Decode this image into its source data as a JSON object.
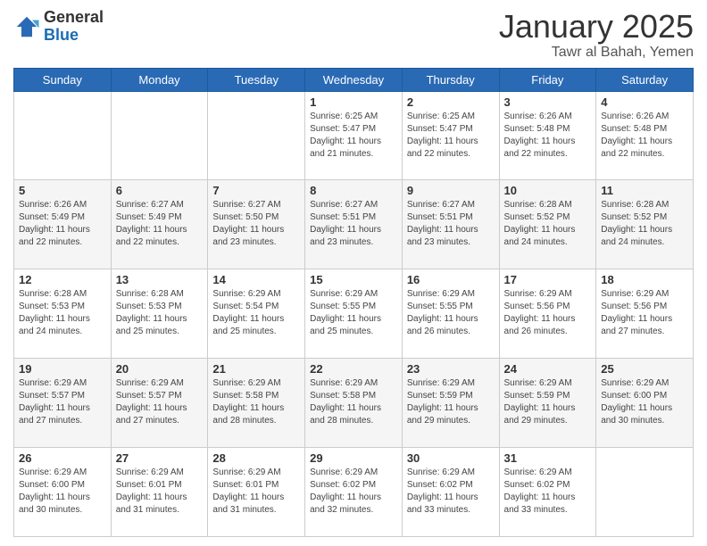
{
  "logo": {
    "general": "General",
    "blue": "Blue"
  },
  "header": {
    "title": "January 2025",
    "subtitle": "Tawr al Bahah, Yemen"
  },
  "weekdays": [
    "Sunday",
    "Monday",
    "Tuesday",
    "Wednesday",
    "Thursday",
    "Friday",
    "Saturday"
  ],
  "weeks": [
    [
      {
        "day": "",
        "info": ""
      },
      {
        "day": "",
        "info": ""
      },
      {
        "day": "",
        "info": ""
      },
      {
        "day": "1",
        "info": "Sunrise: 6:25 AM\nSunset: 5:47 PM\nDaylight: 11 hours\nand 21 minutes."
      },
      {
        "day": "2",
        "info": "Sunrise: 6:25 AM\nSunset: 5:47 PM\nDaylight: 11 hours\nand 22 minutes."
      },
      {
        "day": "3",
        "info": "Sunrise: 6:26 AM\nSunset: 5:48 PM\nDaylight: 11 hours\nand 22 minutes."
      },
      {
        "day": "4",
        "info": "Sunrise: 6:26 AM\nSunset: 5:48 PM\nDaylight: 11 hours\nand 22 minutes."
      }
    ],
    [
      {
        "day": "5",
        "info": "Sunrise: 6:26 AM\nSunset: 5:49 PM\nDaylight: 11 hours\nand 22 minutes."
      },
      {
        "day": "6",
        "info": "Sunrise: 6:27 AM\nSunset: 5:49 PM\nDaylight: 11 hours\nand 22 minutes."
      },
      {
        "day": "7",
        "info": "Sunrise: 6:27 AM\nSunset: 5:50 PM\nDaylight: 11 hours\nand 23 minutes."
      },
      {
        "day": "8",
        "info": "Sunrise: 6:27 AM\nSunset: 5:51 PM\nDaylight: 11 hours\nand 23 minutes."
      },
      {
        "day": "9",
        "info": "Sunrise: 6:27 AM\nSunset: 5:51 PM\nDaylight: 11 hours\nand 23 minutes."
      },
      {
        "day": "10",
        "info": "Sunrise: 6:28 AM\nSunset: 5:52 PM\nDaylight: 11 hours\nand 24 minutes."
      },
      {
        "day": "11",
        "info": "Sunrise: 6:28 AM\nSunset: 5:52 PM\nDaylight: 11 hours\nand 24 minutes."
      }
    ],
    [
      {
        "day": "12",
        "info": "Sunrise: 6:28 AM\nSunset: 5:53 PM\nDaylight: 11 hours\nand 24 minutes."
      },
      {
        "day": "13",
        "info": "Sunrise: 6:28 AM\nSunset: 5:53 PM\nDaylight: 11 hours\nand 25 minutes."
      },
      {
        "day": "14",
        "info": "Sunrise: 6:29 AM\nSunset: 5:54 PM\nDaylight: 11 hours\nand 25 minutes."
      },
      {
        "day": "15",
        "info": "Sunrise: 6:29 AM\nSunset: 5:55 PM\nDaylight: 11 hours\nand 25 minutes."
      },
      {
        "day": "16",
        "info": "Sunrise: 6:29 AM\nSunset: 5:55 PM\nDaylight: 11 hours\nand 26 minutes."
      },
      {
        "day": "17",
        "info": "Sunrise: 6:29 AM\nSunset: 5:56 PM\nDaylight: 11 hours\nand 26 minutes."
      },
      {
        "day": "18",
        "info": "Sunrise: 6:29 AM\nSunset: 5:56 PM\nDaylight: 11 hours\nand 27 minutes."
      }
    ],
    [
      {
        "day": "19",
        "info": "Sunrise: 6:29 AM\nSunset: 5:57 PM\nDaylight: 11 hours\nand 27 minutes."
      },
      {
        "day": "20",
        "info": "Sunrise: 6:29 AM\nSunset: 5:57 PM\nDaylight: 11 hours\nand 27 minutes."
      },
      {
        "day": "21",
        "info": "Sunrise: 6:29 AM\nSunset: 5:58 PM\nDaylight: 11 hours\nand 28 minutes."
      },
      {
        "day": "22",
        "info": "Sunrise: 6:29 AM\nSunset: 5:58 PM\nDaylight: 11 hours\nand 28 minutes."
      },
      {
        "day": "23",
        "info": "Sunrise: 6:29 AM\nSunset: 5:59 PM\nDaylight: 11 hours\nand 29 minutes."
      },
      {
        "day": "24",
        "info": "Sunrise: 6:29 AM\nSunset: 5:59 PM\nDaylight: 11 hours\nand 29 minutes."
      },
      {
        "day": "25",
        "info": "Sunrise: 6:29 AM\nSunset: 6:00 PM\nDaylight: 11 hours\nand 30 minutes."
      }
    ],
    [
      {
        "day": "26",
        "info": "Sunrise: 6:29 AM\nSunset: 6:00 PM\nDaylight: 11 hours\nand 30 minutes."
      },
      {
        "day": "27",
        "info": "Sunrise: 6:29 AM\nSunset: 6:01 PM\nDaylight: 11 hours\nand 31 minutes."
      },
      {
        "day": "28",
        "info": "Sunrise: 6:29 AM\nSunset: 6:01 PM\nDaylight: 11 hours\nand 31 minutes."
      },
      {
        "day": "29",
        "info": "Sunrise: 6:29 AM\nSunset: 6:02 PM\nDaylight: 11 hours\nand 32 minutes."
      },
      {
        "day": "30",
        "info": "Sunrise: 6:29 AM\nSunset: 6:02 PM\nDaylight: 11 hours\nand 33 minutes."
      },
      {
        "day": "31",
        "info": "Sunrise: 6:29 AM\nSunset: 6:02 PM\nDaylight: 11 hours\nand 33 minutes."
      },
      {
        "day": "",
        "info": ""
      }
    ]
  ]
}
